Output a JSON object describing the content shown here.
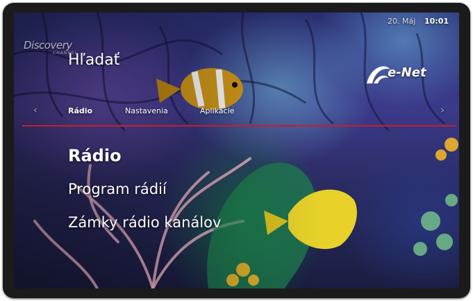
{
  "status": {
    "date": "20. Máj",
    "time": "10:01"
  },
  "watermark": {
    "channel": "Discovery",
    "channel_sub": "CHANNEL"
  },
  "header": {
    "title": "Hľadať",
    "brand": "e-Net"
  },
  "tabs": [
    {
      "label": "Rádio",
      "active": true
    },
    {
      "label": "Nastavenia",
      "active": false
    },
    {
      "label": "Aplikácie",
      "active": false
    }
  ],
  "menu": {
    "items": [
      {
        "label": "Rádio",
        "selected": true
      },
      {
        "label": "Program rádií",
        "selected": false
      },
      {
        "label": "Zámky rádio kanálov",
        "selected": false
      }
    ]
  },
  "nav": {
    "left": "‹",
    "right": "›"
  },
  "colors": {
    "accent_line": "#c71f2a",
    "text": "#ffffff"
  }
}
